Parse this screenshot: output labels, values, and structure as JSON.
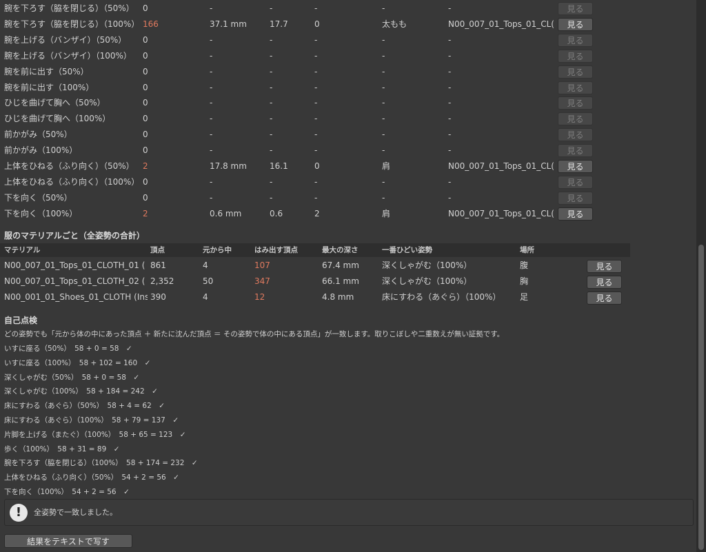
{
  "pose_rows": [
    {
      "label": "腕を下ろす（脇を閉じる）（50%）",
      "count": "0",
      "depth": "-",
      "ratio": "-",
      "c4": "-",
      "part": "-",
      "material": "-",
      "button": "見る",
      "alert": false,
      "enabled": false
    },
    {
      "label": "腕を下ろす（脇を閉じる）（100%）",
      "count": "166",
      "depth": "37.1 mm",
      "ratio": "17.7",
      "c4": "0",
      "part": "太もも",
      "material": "N00_007_01_Tops_01_CL(",
      "button": "見る",
      "alert": true,
      "enabled": true
    },
    {
      "label": "腕を上げる（バンザイ）（50%）",
      "count": "0",
      "depth": "-",
      "ratio": "-",
      "c4": "-",
      "part": "-",
      "material": "-",
      "button": "見る",
      "alert": false,
      "enabled": false
    },
    {
      "label": "腕を上げる（バンザイ）（100%）",
      "count": "0",
      "depth": "-",
      "ratio": "-",
      "c4": "-",
      "part": "-",
      "material": "-",
      "button": "見る",
      "alert": false,
      "enabled": false
    },
    {
      "label": "腕を前に出す（50%）",
      "count": "0",
      "depth": "-",
      "ratio": "-",
      "c4": "-",
      "part": "-",
      "material": "-",
      "button": "見る",
      "alert": false,
      "enabled": false
    },
    {
      "label": "腕を前に出す（100%）",
      "count": "0",
      "depth": "-",
      "ratio": "-",
      "c4": "-",
      "part": "-",
      "material": "-",
      "button": "見る",
      "alert": false,
      "enabled": false
    },
    {
      "label": "ひじを曲げて胸へ（50%）",
      "count": "0",
      "depth": "-",
      "ratio": "-",
      "c4": "-",
      "part": "-",
      "material": "-",
      "button": "見る",
      "alert": false,
      "enabled": false
    },
    {
      "label": "ひじを曲げて胸へ（100%）",
      "count": "0",
      "depth": "-",
      "ratio": "-",
      "c4": "-",
      "part": "-",
      "material": "-",
      "button": "見る",
      "alert": false,
      "enabled": false
    },
    {
      "label": "前かがみ（50%）",
      "count": "0",
      "depth": "-",
      "ratio": "-",
      "c4": "-",
      "part": "-",
      "material": "-",
      "button": "見る",
      "alert": false,
      "enabled": false
    },
    {
      "label": "前かがみ（100%）",
      "count": "0",
      "depth": "-",
      "ratio": "-",
      "c4": "-",
      "part": "-",
      "material": "-",
      "button": "見る",
      "alert": false,
      "enabled": false
    },
    {
      "label": "上体をひねる（ふり向く）（50%）",
      "count": "2",
      "depth": "17.8 mm",
      "ratio": "16.1",
      "c4": "0",
      "part": "肩",
      "material": "N00_007_01_Tops_01_CL(",
      "button": "見る",
      "alert": true,
      "enabled": true
    },
    {
      "label": "上体をひねる（ふり向く）（100%）",
      "count": "0",
      "depth": "-",
      "ratio": "-",
      "c4": "-",
      "part": "-",
      "material": "-",
      "button": "見る",
      "alert": false,
      "enabled": false
    },
    {
      "label": "下を向く（50%）",
      "count": "0",
      "depth": "-",
      "ratio": "-",
      "c4": "-",
      "part": "-",
      "material": "-",
      "button": "見る",
      "alert": false,
      "enabled": false
    },
    {
      "label": "下を向く（100%）",
      "count": "2",
      "depth": "0.6 mm",
      "ratio": "0.6",
      "c4": "2",
      "part": "肩",
      "material": "N00_007_01_Tops_01_CL(",
      "button": "見る",
      "alert": true,
      "enabled": true
    }
  ],
  "material_section": {
    "title": "服のマテリアルごと（全姿勢の合計）",
    "headers": {
      "material": "マテリアル",
      "vertices": "頂点",
      "original": "元から中",
      "protruding": "はみ出す頂点",
      "max_depth": "最大の深さ",
      "worst_pose": "一番ひどい姿勢",
      "location": "場所"
    },
    "rows": [
      {
        "material": "N00_007_01_Tops_01_CLOTH_01 (",
        "vertices": "861",
        "original": "4",
        "protruding": "107",
        "max_depth": "67.4 mm",
        "worst_pose": "深くしゃがむ（100%）",
        "location": "腹",
        "button": "見る"
      },
      {
        "material": "N00_007_01_Tops_01_CLOTH_02 (",
        "vertices": "2,352",
        "original": "50",
        "protruding": "347",
        "max_depth": "66.1 mm",
        "worst_pose": "深くしゃがむ（100%）",
        "location": "胸",
        "button": "見る"
      },
      {
        "material": "N00_001_01_Shoes_01_CLOTH (Ins",
        "vertices": "390",
        "original": "4",
        "protruding": "12",
        "max_depth": "4.8 mm",
        "worst_pose": "床にすわる（あぐら）（100%）",
        "location": "足",
        "button": "見る"
      }
    ]
  },
  "self_check": {
    "title": "自己点検",
    "description": "どの姿勢でも「元から体の中にあった頂点 ＋ 新たに沈んだ頂点 ＝ その姿勢で体の中にある頂点」が一致します。取りこぼしや二重数えが無い証拠です。",
    "lines": [
      "いすに座る（50%）　58 + 0 = 58　✓",
      "いすに座る（100%）　58 + 102 = 160　✓",
      "深くしゃがむ（50%）　58 + 0 = 58　✓",
      "深くしゃがむ（100%）　58 + 184 = 242　✓",
      "床にすわる（あぐら）（50%）　58 + 4 = 62　✓",
      "床にすわる（あぐら）（100%）　58 + 79 = 137　✓",
      "片脚を上げる（またぐ）（100%）　58 + 65 = 123　✓",
      "歩く（100%）　58 + 31 = 89　✓",
      "腕を下ろす（脇を閉じる）（100%）　58 + 174 = 232　✓",
      "上体をひねる（ふり向く）（50%）　54 + 2 = 56　✓",
      "下を向く（100%）　54 + 2 = 56　✓"
    ]
  },
  "info_icon": "exclamation-icon",
  "info_message": "全姿勢で一致しました。",
  "copy_button": "結果をテキストで写す",
  "colors": {
    "alert": "#e07a5f",
    "background": "#383838"
  }
}
